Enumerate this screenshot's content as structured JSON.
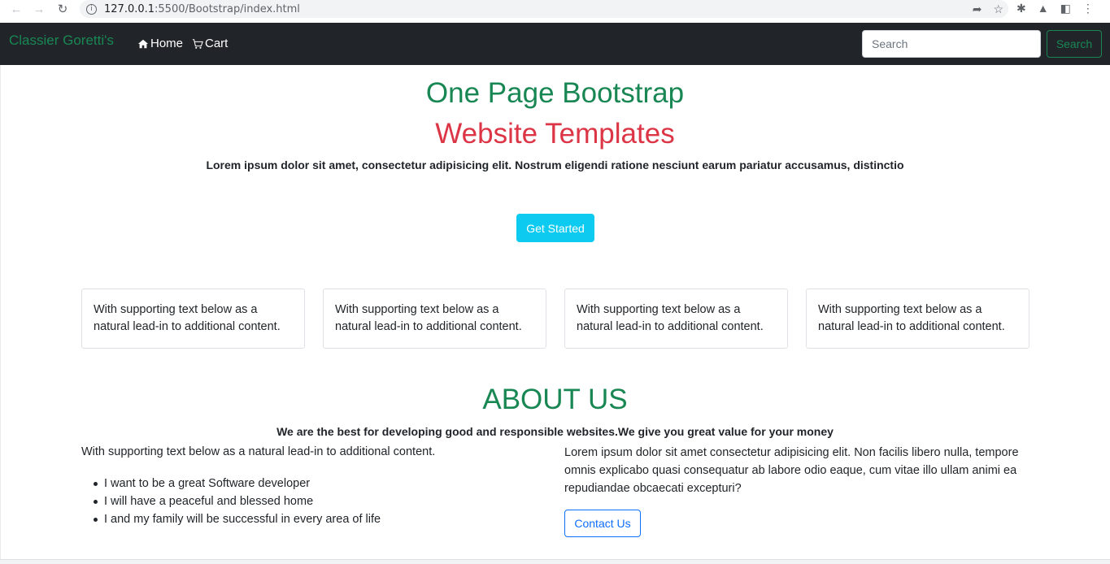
{
  "browser": {
    "url_host": "127.0.0.1",
    "url_path": ":5500/Bootstrap/index.html"
  },
  "navbar": {
    "brand": "Classier Goretti's",
    "links": [
      {
        "label": "Home",
        "icon": "house-icon"
      },
      {
        "label": "Cart",
        "icon": "cart-icon"
      }
    ],
    "search_placeholder": "Search",
    "search_button": "Search"
  },
  "hero": {
    "title_line1": "One Page Bootstrap",
    "title_line2": "Website Templates",
    "lead": "Lorem ipsum dolor sit amet, consectetur adipisicing elit. Nostrum eligendi ratione nesciunt earum pariatur accusamus, distinctio",
    "cta": "Get Started"
  },
  "cards": [
    "With supporting text below as a natural lead-in to additional content.",
    "With supporting text below as a natural lead-in to additional content.",
    "With supporting text below as a natural lead-in to additional content.",
    "With supporting text below as a natural lead-in to additional content."
  ],
  "about": {
    "title": "ABOUT US",
    "subtitle": "We are the best for developing good and responsible websites.We give you great value for your money",
    "left_text": "With supporting text below as a natural lead-in to additional content.",
    "list": [
      "I want to be a great Software developer",
      "I will have a peaceful and blessed home",
      "I and my family will be successful in every area of life"
    ],
    "right_text": "Lorem ipsum dolor sit amet consectetur adipisicing elit. Non facilis libero nulla, tempore omnis explicabo quasi consequatur ab labore odio eaque, cum vitae illo ullam animi ea repudiandae obcaecati excepturi?",
    "contact_button": "Contact Us"
  },
  "colors": {
    "brand_green": "#198754",
    "title_red": "#dc3545",
    "info_cyan": "#0dcaf0",
    "primary_blue": "#0d6efd",
    "navbar_dark": "#212529"
  }
}
